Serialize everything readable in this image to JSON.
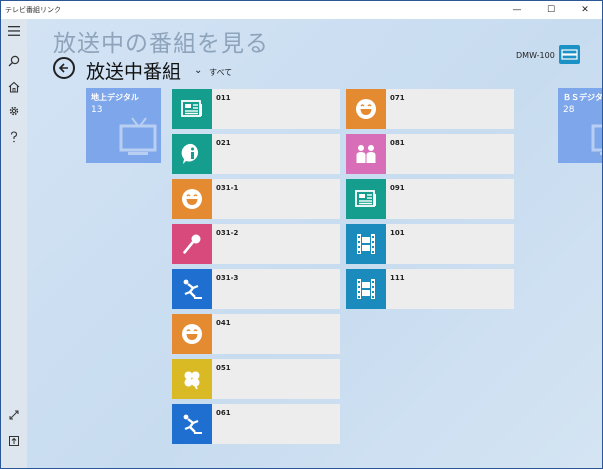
{
  "window": {
    "app_title": "テレビ番組リンク",
    "min_glyph": "—",
    "max_glyph": "☐",
    "close_glyph": "✕"
  },
  "header": {
    "title": "放送中の番組を見る",
    "subtitle": "放送中番組",
    "filter": "すべて",
    "device": "DMW-100"
  },
  "categories": [
    {
      "name": "地上デジタル",
      "count": "13",
      "icon": "tv-icon"
    },
    {
      "name": "ＢＳデジタル",
      "count": "28",
      "icon": "tv-icon"
    }
  ],
  "channels": [
    {
      "num": "011",
      "icon": "news-icon",
      "color": "#159d8d"
    },
    {
      "num": "021",
      "icon": "info-icon",
      "color": "#159d8d"
    },
    {
      "num": "031-1",
      "icon": "smiley-icon",
      "color": "#e48a30"
    },
    {
      "num": "031-2",
      "icon": "microphone-icon",
      "color": "#d8497c"
    },
    {
      "num": "031-3",
      "icon": "sports-icon",
      "color": "#1f6fd0"
    },
    {
      "num": "041",
      "icon": "smiley-icon",
      "color": "#e48a30"
    },
    {
      "num": "051",
      "icon": "clover-icon",
      "color": "#d9ba25"
    },
    {
      "num": "061",
      "icon": "sports-icon",
      "color": "#1f6fd0"
    },
    {
      "num": "071",
      "icon": "smiley-icon",
      "color": "#e48a30"
    },
    {
      "num": "081",
      "icon": "kids-icon",
      "color": "#d86eb8"
    },
    {
      "num": "091",
      "icon": "news-icon",
      "color": "#159d8d"
    },
    {
      "num": "101",
      "icon": "film-icon",
      "color": "#1b8bbe"
    },
    {
      "num": "111",
      "icon": "film-icon",
      "color": "#1b8bbe"
    }
  ]
}
